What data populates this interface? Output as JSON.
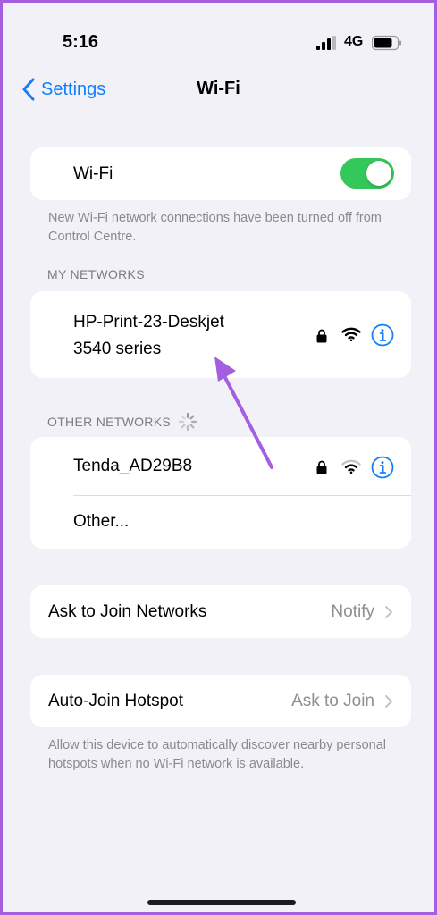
{
  "status_bar": {
    "time": "5:16",
    "network": "4G",
    "icons": [
      "signal-bars-icon",
      "battery-icon"
    ]
  },
  "nav": {
    "back_label": "Settings",
    "title": "Wi-Fi",
    "back_icon": "chevron-left-icon"
  },
  "wifi_toggle": {
    "label": "Wi-Fi",
    "state": "on"
  },
  "wifi_note": "New Wi-Fi network connections have been turned off from Control Centre.",
  "my_networks": {
    "header": "MY NETWORKS",
    "items": [
      {
        "name_line1": "HP-Print-23-Deskjet",
        "name_line2": "3540 series",
        "secured": true
      }
    ]
  },
  "other_networks": {
    "header": "OTHER NETWORKS",
    "items": [
      {
        "name": "Tenda_AD29B8",
        "secured": true
      },
      {
        "name": "Other..."
      }
    ]
  },
  "ask_to_join": {
    "label": "Ask to Join Networks",
    "value": "Notify"
  },
  "auto_join": {
    "label": "Auto-Join Hotspot",
    "value": "Ask to Join"
  },
  "auto_join_note": "Allow this device to automatically discover nearby personal hotspots when no Wi-Fi network is available.",
  "colors": {
    "accent": "#147efb",
    "toggle_on": "#34c759",
    "annotation_arrow": "#a45ee0",
    "frame_border": "#a45ee0"
  }
}
